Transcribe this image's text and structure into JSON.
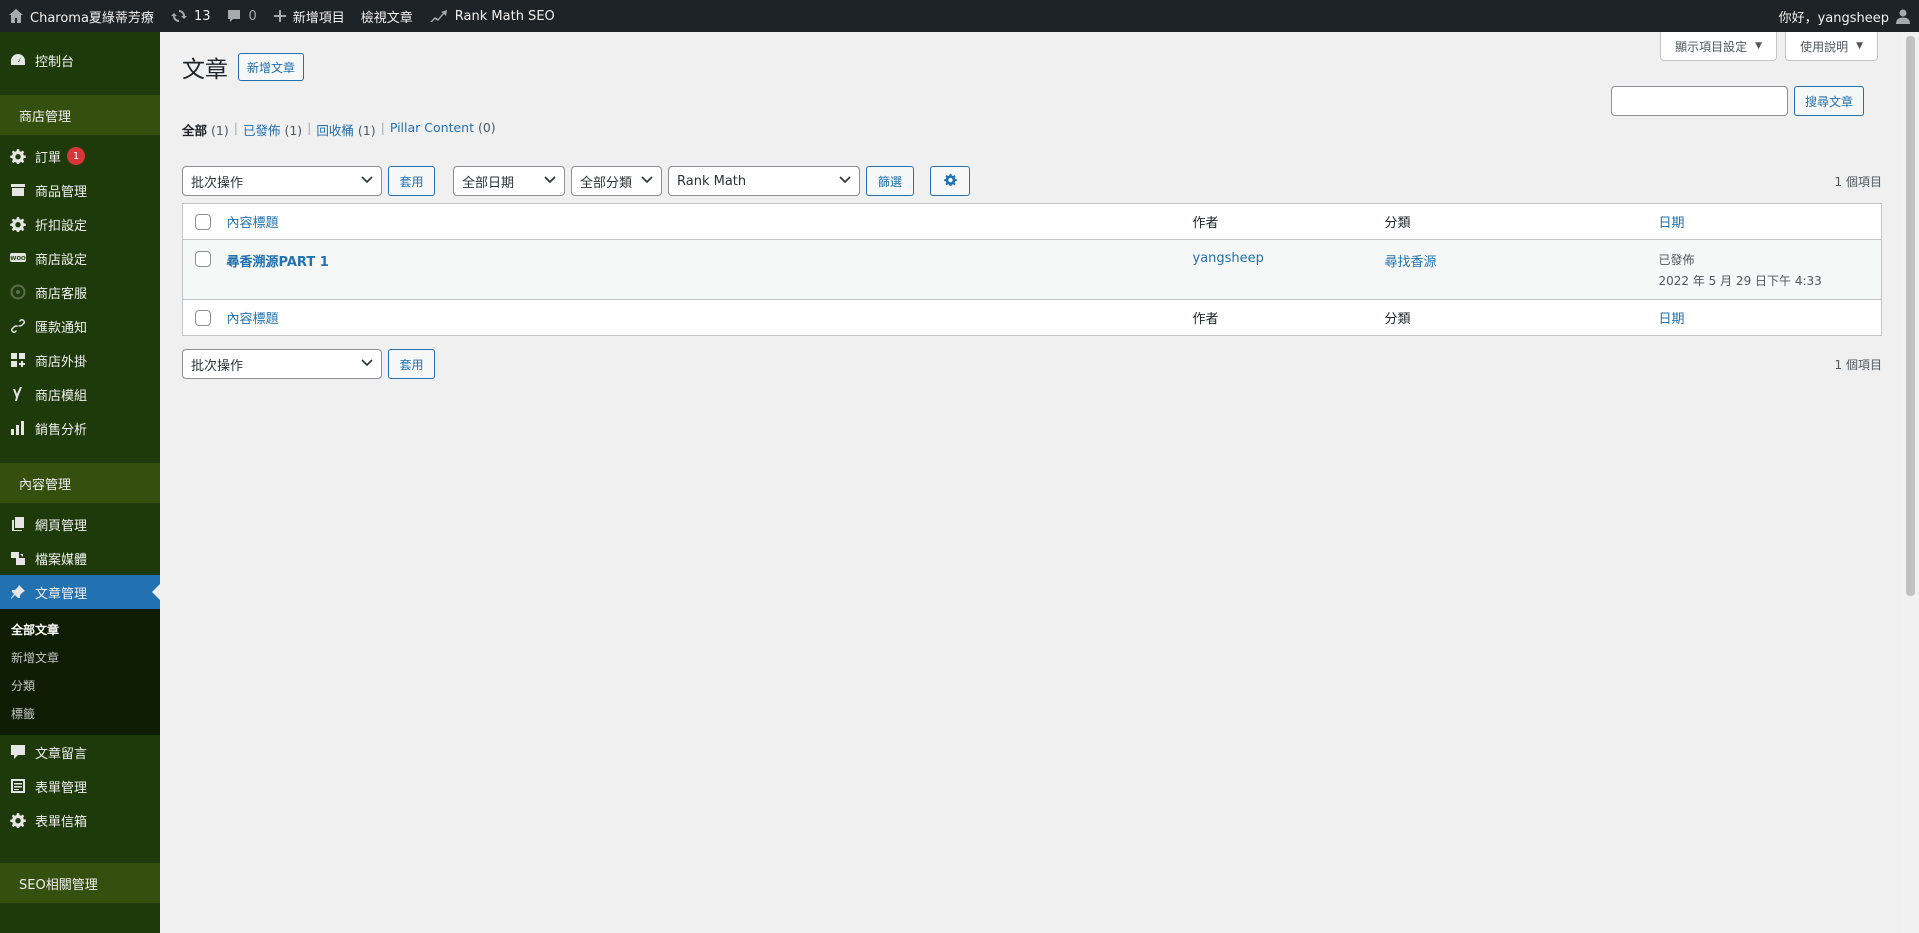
{
  "adminbar": {
    "site_name": "Charoma夏綠蒂芳療",
    "updates": "13",
    "comments": "0",
    "new_content": "新增項目",
    "view_posts": "檢視文章",
    "rank_math": "Rank Math SEO",
    "greeting": "你好，yangsheep"
  },
  "sidebar": {
    "dashboard": "控制台",
    "shop_header": "商店管理",
    "shop_items": [
      {
        "label": "訂單",
        "icon": "gear-icon",
        "badge": "1"
      },
      {
        "label": "商品管理",
        "icon": "archive-icon"
      },
      {
        "label": "折扣設定",
        "icon": "gear-icon"
      },
      {
        "label": "商店設定",
        "icon": "woo-icon"
      },
      {
        "label": "商店客服",
        "icon": "chat-icon"
      },
      {
        "label": "匯款通知",
        "icon": "link-icon"
      },
      {
        "label": "商店外掛",
        "icon": "plugin-icon"
      },
      {
        "label": "商店模組",
        "icon": "yoast-icon"
      },
      {
        "label": "銷售分析",
        "icon": "chart-icon"
      }
    ],
    "content_header": "內容管理",
    "content_items": [
      {
        "label": "網頁管理",
        "icon": "pages-icon"
      },
      {
        "label": "檔案媒體",
        "icon": "media-icon"
      },
      {
        "label": "文章管理",
        "icon": "pin-icon"
      }
    ],
    "post_submenu": [
      "全部文章",
      "新增文章",
      "分類",
      "標籤"
    ],
    "after_items": [
      {
        "label": "文章留言",
        "icon": "comment-icon"
      },
      {
        "label": "表單管理",
        "icon": "form-icon"
      },
      {
        "label": "表單信箱",
        "icon": "gear-icon"
      }
    ],
    "seo_header": "SEO相關管理"
  },
  "screen": {
    "options": "顯示項目設定",
    "help": "使用說明"
  },
  "page": {
    "title": "文章",
    "add_new": "新增文章",
    "search_button": "搜尋文章"
  },
  "filters": {
    "all": "全部",
    "all_count": "(1)",
    "published": "已發佈",
    "published_count": "(1)",
    "trash": "回收桶",
    "trash_count": "(1)",
    "pillar": "Pillar Content",
    "pillar_count": "(0)",
    "sep": "|"
  },
  "tablenav_top": {
    "bulk": "批次操作",
    "apply": "套用",
    "dates": "全部日期",
    "categories": "全部分類",
    "rankmath": "Rank Math",
    "filter": "篩選",
    "count": "1 個項目"
  },
  "table": {
    "columns": {
      "title": "內容標題",
      "author": "作者",
      "category": "分類",
      "date": "日期"
    },
    "rows": [
      {
        "title": "尋香溯源PART 1",
        "author": "yangsheep",
        "category": "尋找香源",
        "status": "已發佈",
        "date": "2022 年 5 月 29 日下午 4:33"
      }
    ]
  },
  "tablenav_bottom": {
    "bulk": "批次操作",
    "apply": "套用",
    "count": "1 個項目"
  }
}
